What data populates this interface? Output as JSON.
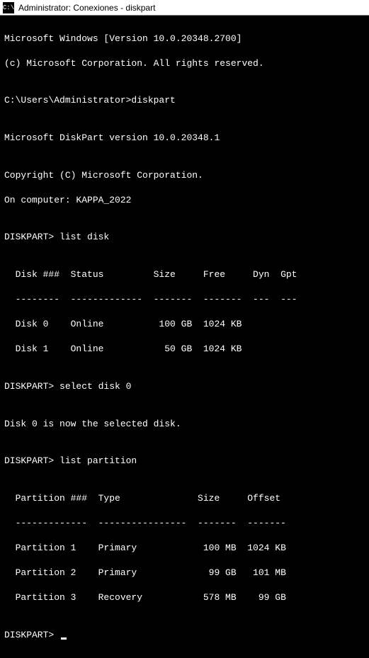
{
  "titlebar": {
    "icon_text": "C:\\",
    "title": "Administrator: Conexiones - diskpart"
  },
  "terminal": {
    "line1": "Microsoft Windows [Version 10.0.20348.2700]",
    "line2": "(c) Microsoft Corporation. All rights reserved.",
    "blank1": "",
    "prompt1": "C:\\Users\\Administrator>diskpart",
    "blank2": "",
    "line3": "Microsoft DiskPart version 10.0.20348.1",
    "blank3": "",
    "line4": "Copyright (C) Microsoft Corporation.",
    "line5": "On computer: KAPPA_2022",
    "blank4": "",
    "prompt2": "DISKPART> list disk",
    "blank5": "",
    "header1": "  Disk ###  Status         Size     Free     Dyn  Gpt",
    "sep1": "  --------  -------------  -------  -------  ---  ---",
    "row1": "  Disk 0    Online          100 GB  1024 KB",
    "row2": "  Disk 1    Online           50 GB  1024 KB",
    "blank6": "",
    "prompt3": "DISKPART> select disk 0",
    "blank7": "",
    "line6": "Disk 0 is now the selected disk.",
    "blank8": "",
    "prompt4": "DISKPART> list partition",
    "blank9": "",
    "header2": "  Partition ###  Type              Size     Offset",
    "sep2": "  -------------  ----------------  -------  -------",
    "prow1": "  Partition 1    Primary            100 MB  1024 KB",
    "prow2": "  Partition 2    Primary             99 GB   101 MB",
    "prow3": "  Partition 3    Recovery           578 MB    99 GB",
    "blank10": "",
    "prompt5": "DISKPART> "
  }
}
